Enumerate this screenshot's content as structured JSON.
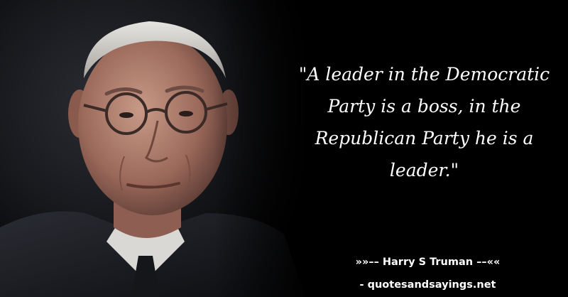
{
  "quote": {
    "text": "\"A leader in the Democratic Party is a boss, in the Republican Party he is a leader.\"",
    "author": "»»–– Harry S Truman ––««",
    "source": "- quotesandsayings.net"
  },
  "colors": {
    "background": "#000000",
    "text": "#ffffff",
    "skin": "#a06e60",
    "suit": "#1c1e24"
  }
}
